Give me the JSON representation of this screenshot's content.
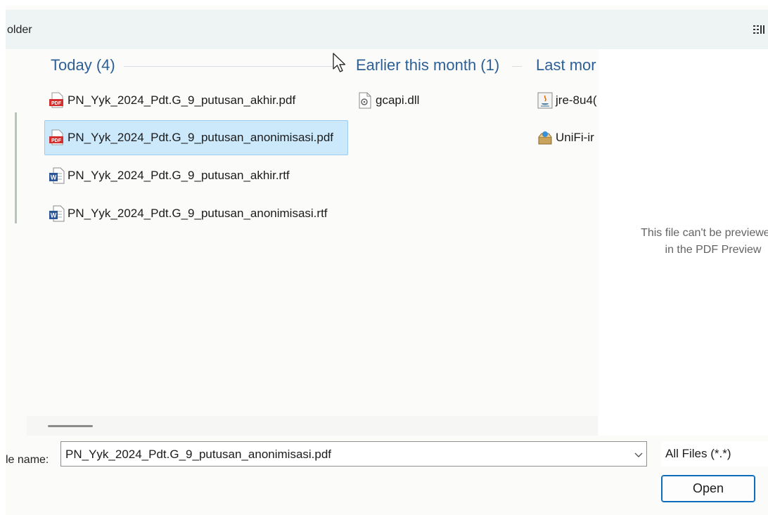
{
  "toolbar": {
    "label": "older",
    "view_icon": "details-view-icon"
  },
  "groups": [
    {
      "header": "Today (4)"
    },
    {
      "header": "Earlier this month (1)"
    },
    {
      "header": "Last mor"
    }
  ],
  "files_today": [
    {
      "name": "PN_Yyk_2024_Pdt.G_9_putusan_akhir.pdf",
      "icon": "pdf-icon",
      "selected": false
    },
    {
      "name": "PN_Yyk_2024_Pdt.G_9_putusan_anonimisasi.pdf",
      "icon": "pdf-icon",
      "selected": true
    },
    {
      "name": "PN_Yyk_2024_Pdt.G_9_putusan_akhir.rtf",
      "icon": "word-icon",
      "selected": false
    },
    {
      "name": "PN_Yyk_2024_Pdt.G_9_putusan_anonimisasi.rtf",
      "icon": "word-icon",
      "selected": false
    }
  ],
  "files_earlier": [
    {
      "name": "gcapi.dll",
      "icon": "dll-icon"
    }
  ],
  "files_last_month": [
    {
      "name": "jre-8u4(",
      "icon": "java-installer-icon"
    },
    {
      "name": "UniFi-ir",
      "icon": "installer-icon"
    }
  ],
  "preview": {
    "line1": "This file can't be previewed b",
    "line2": "in the PDF Preview"
  },
  "filename": {
    "label": "le name:",
    "value": "PN_Yyk_2024_Pdt.G_9_putusan_anonimisasi.pdf"
  },
  "filetype": {
    "value": "All Files (*.*)"
  },
  "buttons": {
    "open": "Open"
  },
  "colors": {
    "accent": "#0f6cbd",
    "selection": "#cce8fb",
    "group_header": "#2d5f97"
  }
}
